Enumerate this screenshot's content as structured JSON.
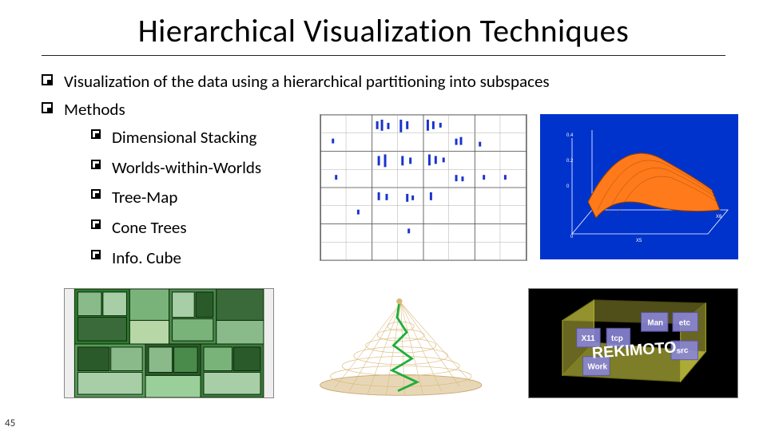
{
  "slide": {
    "title": "Hierarchical Visualization Techniques",
    "page_number": "45",
    "bullets": [
      "Visualization of the data using a hierarchical partitioning into subspaces",
      "Methods"
    ],
    "sub_bullets": [
      "Dimensional Stacking",
      "Worlds-within-Worlds",
      "Tree-Map",
      "Cone Trees",
      "Info. Cube"
    ],
    "figures": {
      "fig1_caption": "Dimensional stacking scatter grid",
      "fig2_caption": "3D surface plot",
      "fig3_caption": "Tree-Map",
      "fig4_caption": "Cone Tree",
      "fig5_caption": "InfoCube REKIMOTO",
      "fig5_labels": {
        "main": "REKIMOTO",
        "l1": "Man",
        "l2": "etc",
        "l3": "src",
        "l4": "X11",
        "l5": "tcp",
        "l6": "Work"
      }
    },
    "colors": {
      "surface_bg": "#0033cc",
      "surface_fill": "#ff7a1a",
      "scatter_dot": "#1a33cc",
      "cone_line": "#1fae3a",
      "cube_face": "#e6e34a"
    }
  }
}
